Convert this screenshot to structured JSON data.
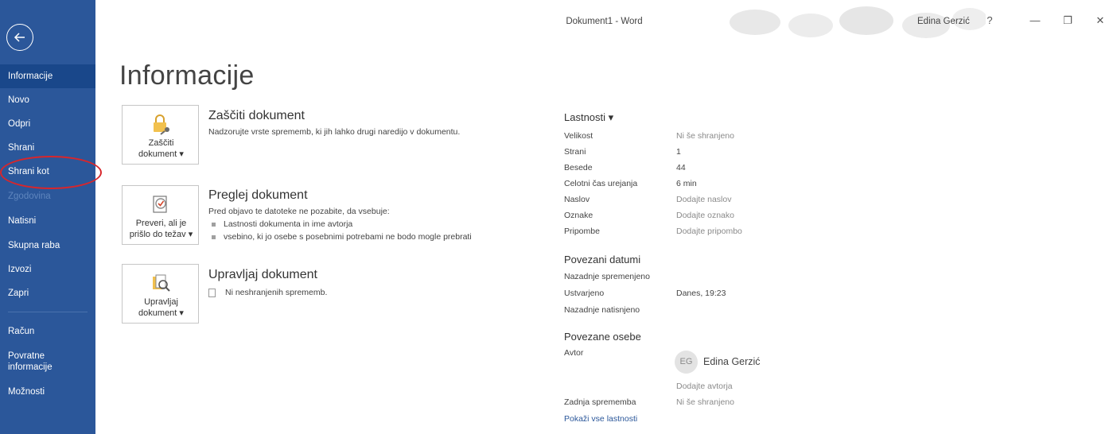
{
  "titlebar": {
    "doc_title": "Dokument1  -  Word",
    "user_name": "Edina Gerzić",
    "help_glyph": "?",
    "minimize_glyph": "—",
    "restore_glyph": "❐",
    "close_glyph": "✕"
  },
  "sidebar": {
    "bg_color": "#2b579a",
    "items": [
      {
        "label": "Informacije"
      },
      {
        "label": "Novo"
      },
      {
        "label": "Odpri"
      },
      {
        "label": "Shrani"
      },
      {
        "label": "Shrani kot"
      },
      {
        "label": "Zgodovina"
      },
      {
        "label": "Natisni"
      },
      {
        "label": "Skupna raba"
      },
      {
        "label": "Izvozi"
      },
      {
        "label": "Zapri"
      },
      {
        "label": "Račun"
      },
      {
        "label": "Povratne informacije"
      },
      {
        "label": "Možnosti"
      }
    ]
  },
  "main": {
    "page_title": "Informacije",
    "protect": {
      "button_line1": "Zaščiti",
      "button_line2": "dokument ▾",
      "title": "Zaščiti dokument",
      "description": "Nadzorujte vrste sprememb, ki jih lahko drugi naredijo v dokumentu."
    },
    "inspect": {
      "button_line1": "Preveri, ali je",
      "button_line2": "prišlo do težav ▾",
      "title": "Preglej dokument",
      "description": "Pred objavo te datoteke ne pozabite, da vsebuje:",
      "bullets": [
        "Lastnosti dokumenta in ime avtorja",
        "vsebino, ki jo osebe s posebnimi potrebami ne bodo mogle prebrati"
      ]
    },
    "manage": {
      "button_line1": "Upravljaj",
      "button_line2": "dokument ▾",
      "title": "Upravljaj dokument",
      "description": "Ni neshranjenih sprememb."
    }
  },
  "properties": {
    "heading": "Lastnosti ▾",
    "rows": [
      {
        "label": "Velikost",
        "value": "Ni še shranjeno"
      },
      {
        "label": "Strani",
        "value": "1"
      },
      {
        "label": "Besede",
        "value": "44"
      },
      {
        "label": "Celotni čas urejanja",
        "value": "6 min"
      },
      {
        "label": "Naslov",
        "value": "Dodajte naslov"
      },
      {
        "label": "Oznake",
        "value": "Dodajte oznako"
      },
      {
        "label": "Pripombe",
        "value": "Dodajte pripombo"
      }
    ],
    "dates_heading": "Povezani datumi",
    "dates": [
      {
        "label": "Nazadnje spremenjeno",
        "value": ""
      },
      {
        "label": "Ustvarjeno",
        "value": "Danes, 19:23"
      },
      {
        "label": "Nazadnje natisnjeno",
        "value": ""
      }
    ],
    "people_heading": "Povezane osebe",
    "author_label": "Avtor",
    "author_initials": "EG",
    "author_name": "Edina Gerzić",
    "add_author": "Dodajte avtorja",
    "last_modified_by_label": "Zadnja sprememba",
    "last_modified_by_value": "Ni še shranjeno",
    "show_all_link": "Pokaži vse lastnosti"
  }
}
